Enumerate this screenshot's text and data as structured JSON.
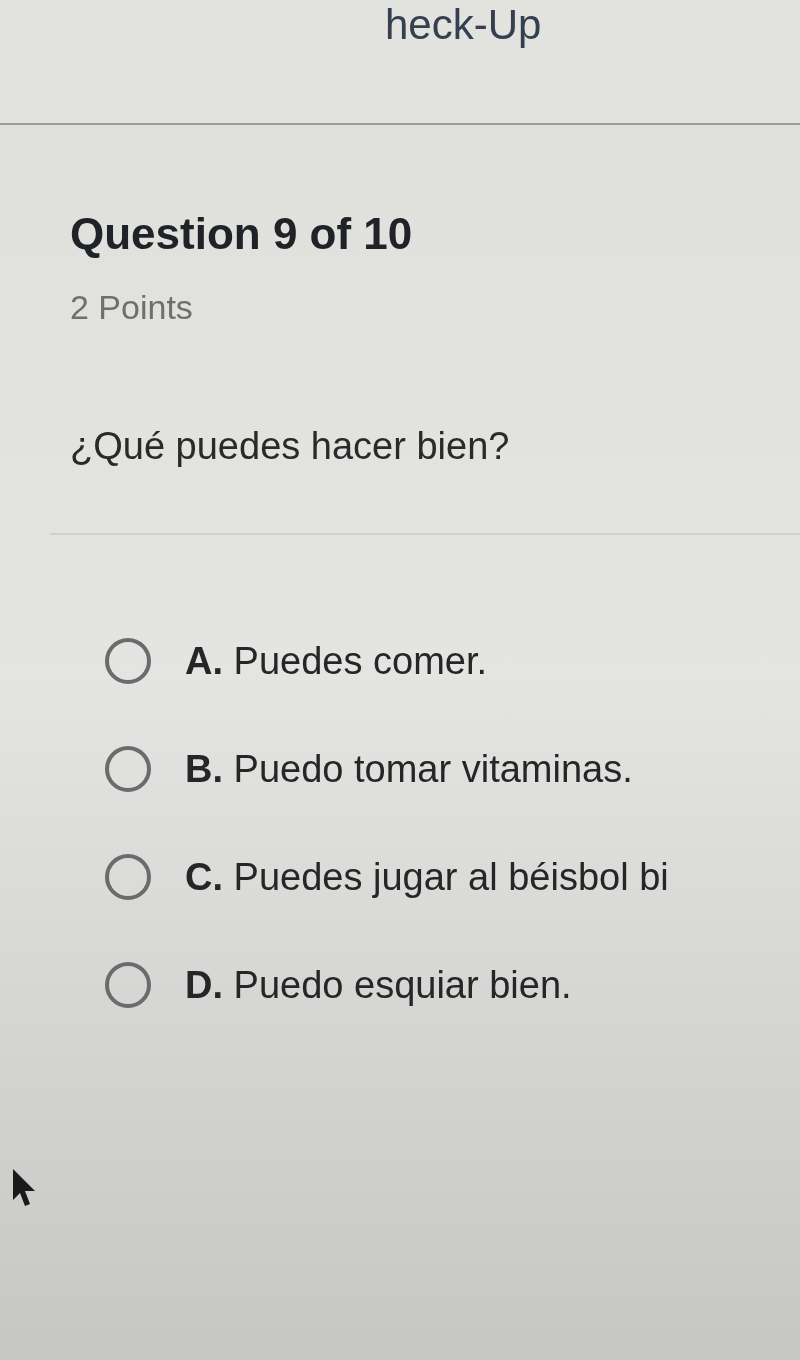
{
  "header": {
    "title": "heck-Up"
  },
  "question": {
    "heading": "Question 9 of 10",
    "points": "2 Points",
    "prompt": "¿Qué puedes hacer bien?"
  },
  "options": [
    {
      "text": "**A.** Puedes comer.",
      "selected": false
    },
    {
      "text": "**B.** Puedo tomar vitaminas.",
      "selected": false
    },
    {
      "text": "**C.** Puedes jugar al béisbol bi",
      "selected": false
    },
    {
      "text": "**D.** Puedo esquiar bien.",
      "selected": false
    }
  ]
}
